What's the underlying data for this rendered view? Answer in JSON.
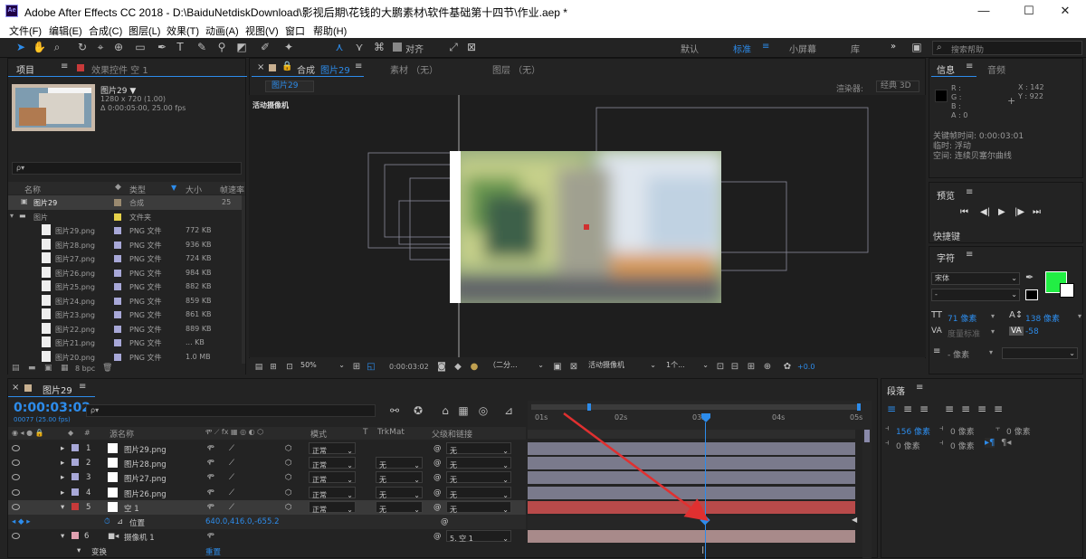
{
  "window": {
    "title": "Adobe After Effects CC 2018 - D:\\BaiduNetdiskDownload\\影视后期\\花钱的大鹏素材\\软件基础第十四节\\作业.aep *",
    "logo": "Ae",
    "minimize": "—",
    "maximize": "☐",
    "close": "✕"
  },
  "menu": [
    "文件(F)",
    "编辑(E)",
    "合成(C)",
    "图层(L)",
    "效果(T)",
    "动画(A)",
    "视图(V)",
    "窗口",
    "帮助(H)"
  ],
  "toolbar": {
    "align_label": "对齐",
    "workspaces": [
      "默认",
      "标准",
      "小屏幕",
      "库"
    ],
    "active_workspace": "标准",
    "search_placeholder": "搜索帮助",
    "more": "»"
  },
  "project": {
    "tab": "项目",
    "effects_tab": "效果控件 空 1",
    "item_name": "图片29 ▼",
    "item_size": "1280 x 720 (1.00)",
    "item_dur": "Δ 0:00:05:00, 25.00 fps",
    "search_prefix": "ρ▾",
    "columns": {
      "name": "名称",
      "type": "类型",
      "size": "大小",
      "rate": "帧速率"
    },
    "top_item": {
      "name": "图片29",
      "type": "合成",
      "rate": "25"
    },
    "folder": {
      "name": "图片",
      "type": "文件夹"
    },
    "files": [
      {
        "name": "图片29.png",
        "type": "PNG 文件",
        "size": "772 KB"
      },
      {
        "name": "图片28.png",
        "type": "PNG 文件",
        "size": "936 KB"
      },
      {
        "name": "图片27.png",
        "type": "PNG 文件",
        "size": "724 KB"
      },
      {
        "name": "图片26.png",
        "type": "PNG 文件",
        "size": "984 KB"
      },
      {
        "name": "图片25.png",
        "type": "PNG 文件",
        "size": "882 KB"
      },
      {
        "name": "图片24.png",
        "type": "PNG 文件",
        "size": "859 KB"
      },
      {
        "name": "图片23.png",
        "type": "PNG 文件",
        "size": "861 KB"
      },
      {
        "name": "图片22.png",
        "type": "PNG 文件",
        "size": "889 KB"
      },
      {
        "name": "图片21.png",
        "type": "PNG 文件",
        "size": "... KB"
      },
      {
        "name": "图片20.png",
        "type": "PNG 文件",
        "size": "1.0 MB"
      }
    ],
    "bpc": "8 bpc"
  },
  "composition": {
    "tab_prefix": "合成",
    "tab_name": "图片29",
    "material_tab": "素材 （无）",
    "layer_tab": "图层 （无）",
    "crumb": "图片29",
    "renderer_label": "渲染器:",
    "renderer": "经典 3D",
    "view_label": "活动摄像机",
    "zoom": "50%",
    "timecode": "0:00:03:02",
    "resolution": "（二分...",
    "camera": "活动摄像机",
    "views": "1个...",
    "exposure": "+0.0"
  },
  "info": {
    "tab": "信息",
    "audio_tab": "音频",
    "r": "R :",
    "g": "G :",
    "b": "B :",
    "a": "A : 0",
    "x": "X : 142",
    "y": "Y : 922",
    "lines": [
      "关键帧时间: 0:00:03:01",
      "临时: 浮动",
      "空间: 连续贝塞尔曲线"
    ]
  },
  "preview": {
    "tab": "预览",
    "shortcut": "快捷键"
  },
  "character": {
    "tab": "字符",
    "font": "宋体",
    "style": "-",
    "size": "71 像素",
    "leading": "138 像素",
    "kern": "度量标准",
    "tracking": "-58",
    "stroke": "- 像素",
    "fill_color": "#22ee44"
  },
  "paragraph": {
    "tab": "段落",
    "indent1": "156 像素",
    "indent2": "0 像素",
    "indent3": "0 像素",
    "space1": "0 像素",
    "space2": "0 像素"
  },
  "timeline": {
    "tab": "图片29",
    "timecode": "0:00:03:02",
    "frame_info": "00077 (25.00 fps)",
    "search_prefix": "ρ▾",
    "cols": {
      "num": "#",
      "source": "源名称",
      "mode": "模式",
      "t": "T",
      "trkmat": "TrkMat",
      "parent": "父级和链接"
    },
    "ruler": [
      "01s",
      "02s",
      "03s",
      "04s",
      "05s"
    ],
    "layers": [
      {
        "num": "1",
        "name": "图片29.png",
        "mode": "正常",
        "trk": "",
        "parent": "无",
        "color": "#a8a8d8"
      },
      {
        "num": "2",
        "name": "图片28.png",
        "mode": "正常",
        "trk": "无",
        "parent": "无",
        "color": "#a8a8d8"
      },
      {
        "num": "3",
        "name": "图片27.png",
        "mode": "正常",
        "trk": "无",
        "parent": "无",
        "color": "#a8a8d8"
      },
      {
        "num": "4",
        "name": "图片26.png",
        "mode": "正常",
        "trk": "无",
        "parent": "无",
        "color": "#a8a8d8"
      },
      {
        "num": "5",
        "name": "空 1",
        "mode": "正常",
        "trk": "无",
        "parent": "无",
        "color": "#c83a3a"
      }
    ],
    "position": {
      "label": "位置",
      "value": "640.0,416.0,-655.2"
    },
    "camera": {
      "num": "6",
      "name": "摄像机 1",
      "parent": "5. 空 1",
      "color": "#e0a0b0"
    },
    "transform": "变换"
  }
}
